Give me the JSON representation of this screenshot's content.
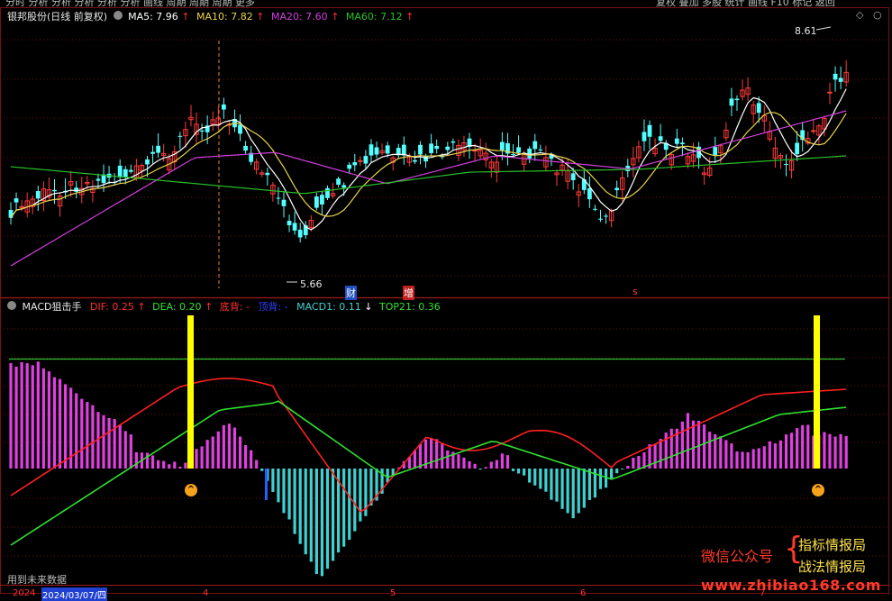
{
  "toolbar": {
    "left_items": [
      "分时",
      "分析",
      "分析",
      "分析",
      "分析",
      "分析",
      "画线",
      "周期",
      "周期",
      "周期",
      "更多"
    ],
    "right_items": [
      "复权",
      "叠加",
      "多股",
      "统计",
      "画线",
      "F10",
      "标记",
      "返回"
    ]
  },
  "main_panel": {
    "title": "银邦股份(日线 前复权)",
    "ma5": "MA5: 7.96",
    "ma10": "MA10: 7.82",
    "ma20": "MA20: 7.60",
    "ma60": "MA60: 7.12",
    "high_label": "8.61",
    "low_label": "5.66",
    "markers": {
      "cai": "财",
      "zeng": "增",
      "s": "s"
    }
  },
  "indicator_panel": {
    "title": "MACD狙击手",
    "dif": "DIF: 0.25",
    "dea": "DEA: 0.20",
    "dibei": "底背: -",
    "dingbei": "顶背: -",
    "macd1": "MACD1: 0.11",
    "top21": "TOP21: 0.36",
    "future_data_note": "用到未来数据"
  },
  "time_axis": {
    "year_label": "2024",
    "date_highlight": "2024/03/07/四",
    "months": [
      "4",
      "5",
      "6",
      "7"
    ]
  },
  "watermark": {
    "wechat_label": "微信公众号",
    "line1": "指标情报局",
    "line2": "战法情报局",
    "url": "www.zhibiao168.com"
  },
  "colors": {
    "up": "#ff3a3a",
    "down": "#54ffff",
    "ma5": "#ffffff",
    "ma10": "#e8d24a",
    "ma20": "#d23ee0",
    "ma60": "#28c028",
    "dif": "#ff2020",
    "dea": "#30e030",
    "macd_pos": "#e040e0",
    "macd_neg": "#40d0d0",
    "signal": "#ffff00"
  }
}
